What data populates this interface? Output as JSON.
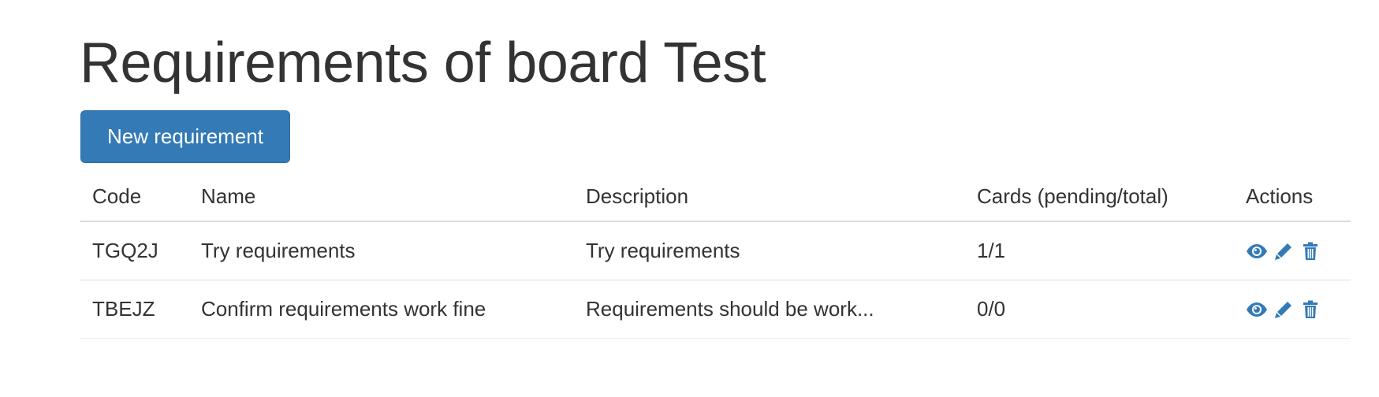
{
  "page": {
    "title": "Requirements of board Test"
  },
  "toolbar": {
    "new_requirement_label": "New requirement"
  },
  "table": {
    "headers": {
      "code": "Code",
      "name": "Name",
      "description": "Description",
      "cards": "Cards (pending/total)",
      "actions": "Actions"
    },
    "rows": [
      {
        "code": "TGQ2J",
        "name": "Try requirements",
        "description": "Try requirements",
        "cards": "1/1",
        "actions": [
          "view-icon",
          "edit-icon",
          "delete-icon"
        ]
      },
      {
        "code": "TBEJZ",
        "name": "Confirm requirements work fine",
        "description": "Requirements should be work...",
        "cards": "0/0",
        "actions": [
          "view-icon",
          "edit-icon",
          "delete-icon"
        ]
      }
    ]
  },
  "colors": {
    "primary": "#337ab7",
    "primary_border": "#2e6da4",
    "text": "#333333",
    "border": "#dddddd"
  }
}
